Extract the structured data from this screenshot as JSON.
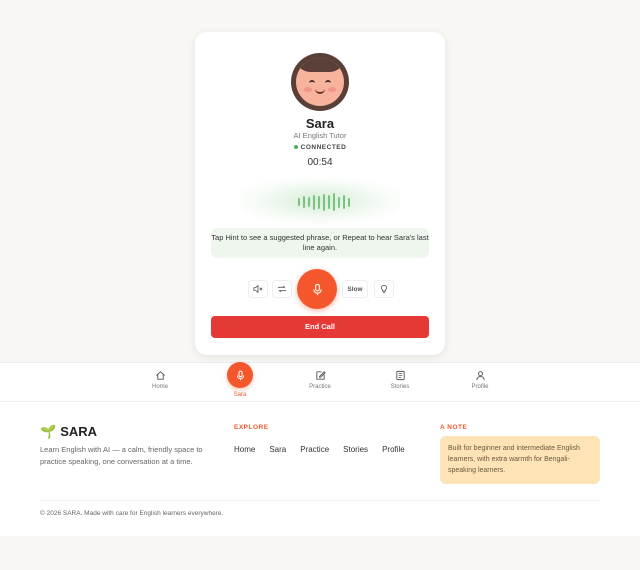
{
  "tutor": {
    "name": "Sara",
    "role": "AI English Tutor",
    "status": "CONNECTED",
    "timer": "00:54"
  },
  "hint_text": "Tap Hint to see a suggested phrase, or Repeat to hear Sara's last line again.",
  "controls": {
    "mute_icon": "speaker-mute-icon",
    "repeat_icon": "repeat-icon",
    "mic_icon": "microphone-icon",
    "slow_label": "Slow",
    "hint_icon": "lightbulb-icon"
  },
  "end_call_label": "End Call",
  "nav": {
    "items": [
      {
        "label": "Home",
        "icon": "home-icon"
      },
      {
        "label": "Sara",
        "icon": "microphone-icon",
        "active": true
      },
      {
        "label": "Practice",
        "icon": "pencil-edit-icon"
      },
      {
        "label": "Stories",
        "icon": "book-icon"
      },
      {
        "label": "Profile",
        "icon": "user-icon"
      }
    ]
  },
  "footer": {
    "brand": "SARA",
    "brand_icon": "seedling-icon",
    "description": "Learn English with AI — a calm, friendly space to practice speaking, one conversation at a time.",
    "explore_heading": "EXPLORE",
    "links": [
      "Home",
      "Sara",
      "Practice",
      "Stories",
      "Profile"
    ],
    "note_heading": "A NOTE",
    "note_text": "Built for beginner and intermediate English learners, with extra warmth for Bengali-speaking learners.",
    "copyright": "© 2026 SARA. Made with care for English learners everywhere."
  },
  "colors": {
    "accent": "#f4572c",
    "end_call": "#e53935",
    "connected": "#4caf50",
    "note_bg": "#fde3b5"
  }
}
